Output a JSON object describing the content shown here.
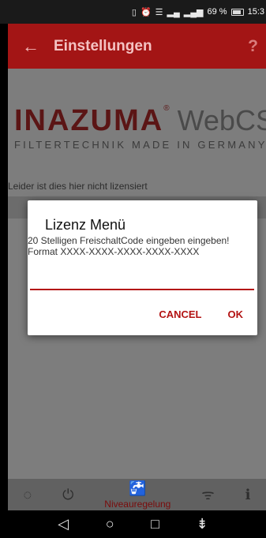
{
  "status_bar": {
    "icons": [
      "vibrate-icon",
      "alarm-icon",
      "wifi-icon",
      "signal-icon",
      "signal-icon"
    ],
    "battery_percent": "69 %",
    "time": "15:3"
  },
  "app_bar": {
    "title": "Einstellungen",
    "back_icon": "←",
    "help_icon": "?"
  },
  "logo": {
    "brand": "INAZUMA",
    "registered": "®",
    "product": "WebCSA",
    "tagline": "FILTERTECHNIK MADE IN GERMANY"
  },
  "license_status": "Leider ist dies hier nicht lizensiert",
  "dialog": {
    "title": "Lizenz Menü",
    "message_line1": "20 Stelligen FreischaltCode eingeben eingeben!",
    "message_line2": "Format XXXX-XXXX-XXXX-XXXX-XXXX",
    "input_value": "",
    "cancel_label": "CANCEL",
    "ok_label": "OK"
  },
  "bottom_nav": {
    "items": [
      {
        "icon": "◌",
        "label": ""
      },
      {
        "icon": "⏻",
        "label": ""
      },
      {
        "icon": "🚰",
        "label": "Niveauregelung"
      },
      {
        "icon": "ᯤ",
        "label": ""
      },
      {
        "icon": "ℹ",
        "label": ""
      }
    ]
  },
  "system_nav": {
    "back": "◁",
    "home": "○",
    "recents": "□",
    "extra": "⇟"
  },
  "colors": {
    "accent": "#b31313",
    "app_bar": "#a31515",
    "overlay_bg": "#7d7d7d"
  }
}
